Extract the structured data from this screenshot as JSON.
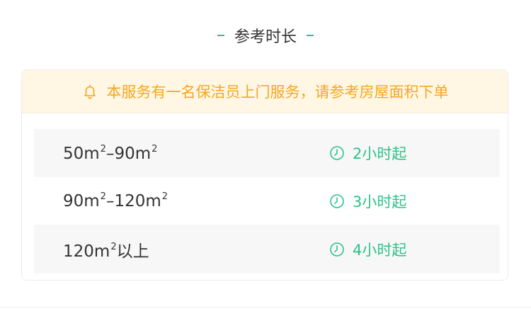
{
  "section": {
    "title": "参考时长"
  },
  "notice": {
    "icon": "bell-icon",
    "text": "本服务有一名保洁员上门服务，请参考房屋面积下单"
  },
  "durations": [
    {
      "area_text": "50m",
      "area_sup": "2",
      "area_mid": "–90m",
      "area_sup2": "2",
      "area_tail": "",
      "duration": "2小时起",
      "icon": "clock-icon"
    },
    {
      "area_text": "90m",
      "area_sup": "2",
      "area_mid": "–120m",
      "area_sup2": "2",
      "area_tail": "",
      "duration": "3小时起",
      "icon": "clock-icon"
    },
    {
      "area_text": "120m",
      "area_sup": "2",
      "area_mid": "",
      "area_sup2": "",
      "area_tail": "以上",
      "duration": "4小时起",
      "icon": "clock-icon"
    }
  ],
  "colors": {
    "accent": "#2cc28a",
    "notice_text": "#f5a623",
    "notice_bg": "#fff7e3",
    "text": "#333333"
  }
}
